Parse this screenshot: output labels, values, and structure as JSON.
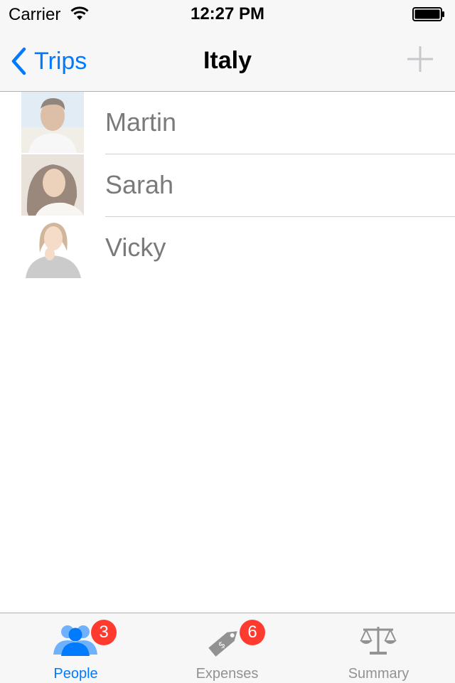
{
  "status_bar": {
    "carrier": "Carrier",
    "time": "12:27 PM"
  },
  "nav_bar": {
    "back_label": "Trips",
    "title": "Italy"
  },
  "people": [
    {
      "name": "Martin"
    },
    {
      "name": "Sarah"
    },
    {
      "name": "Vicky"
    }
  ],
  "tabs": [
    {
      "label": "People",
      "badge": "3",
      "icon": "people-icon",
      "active": true
    },
    {
      "label": "Expenses",
      "badge": "6",
      "icon": "price-tag-icon",
      "active": false
    },
    {
      "label": "Summary",
      "badge": "",
      "icon": "scales-icon",
      "active": false
    }
  ],
  "colors": {
    "accent": "#007aff",
    "badge": "#ff3b30",
    "bar_background": "#f7f7f7",
    "inactive": "#929292"
  }
}
